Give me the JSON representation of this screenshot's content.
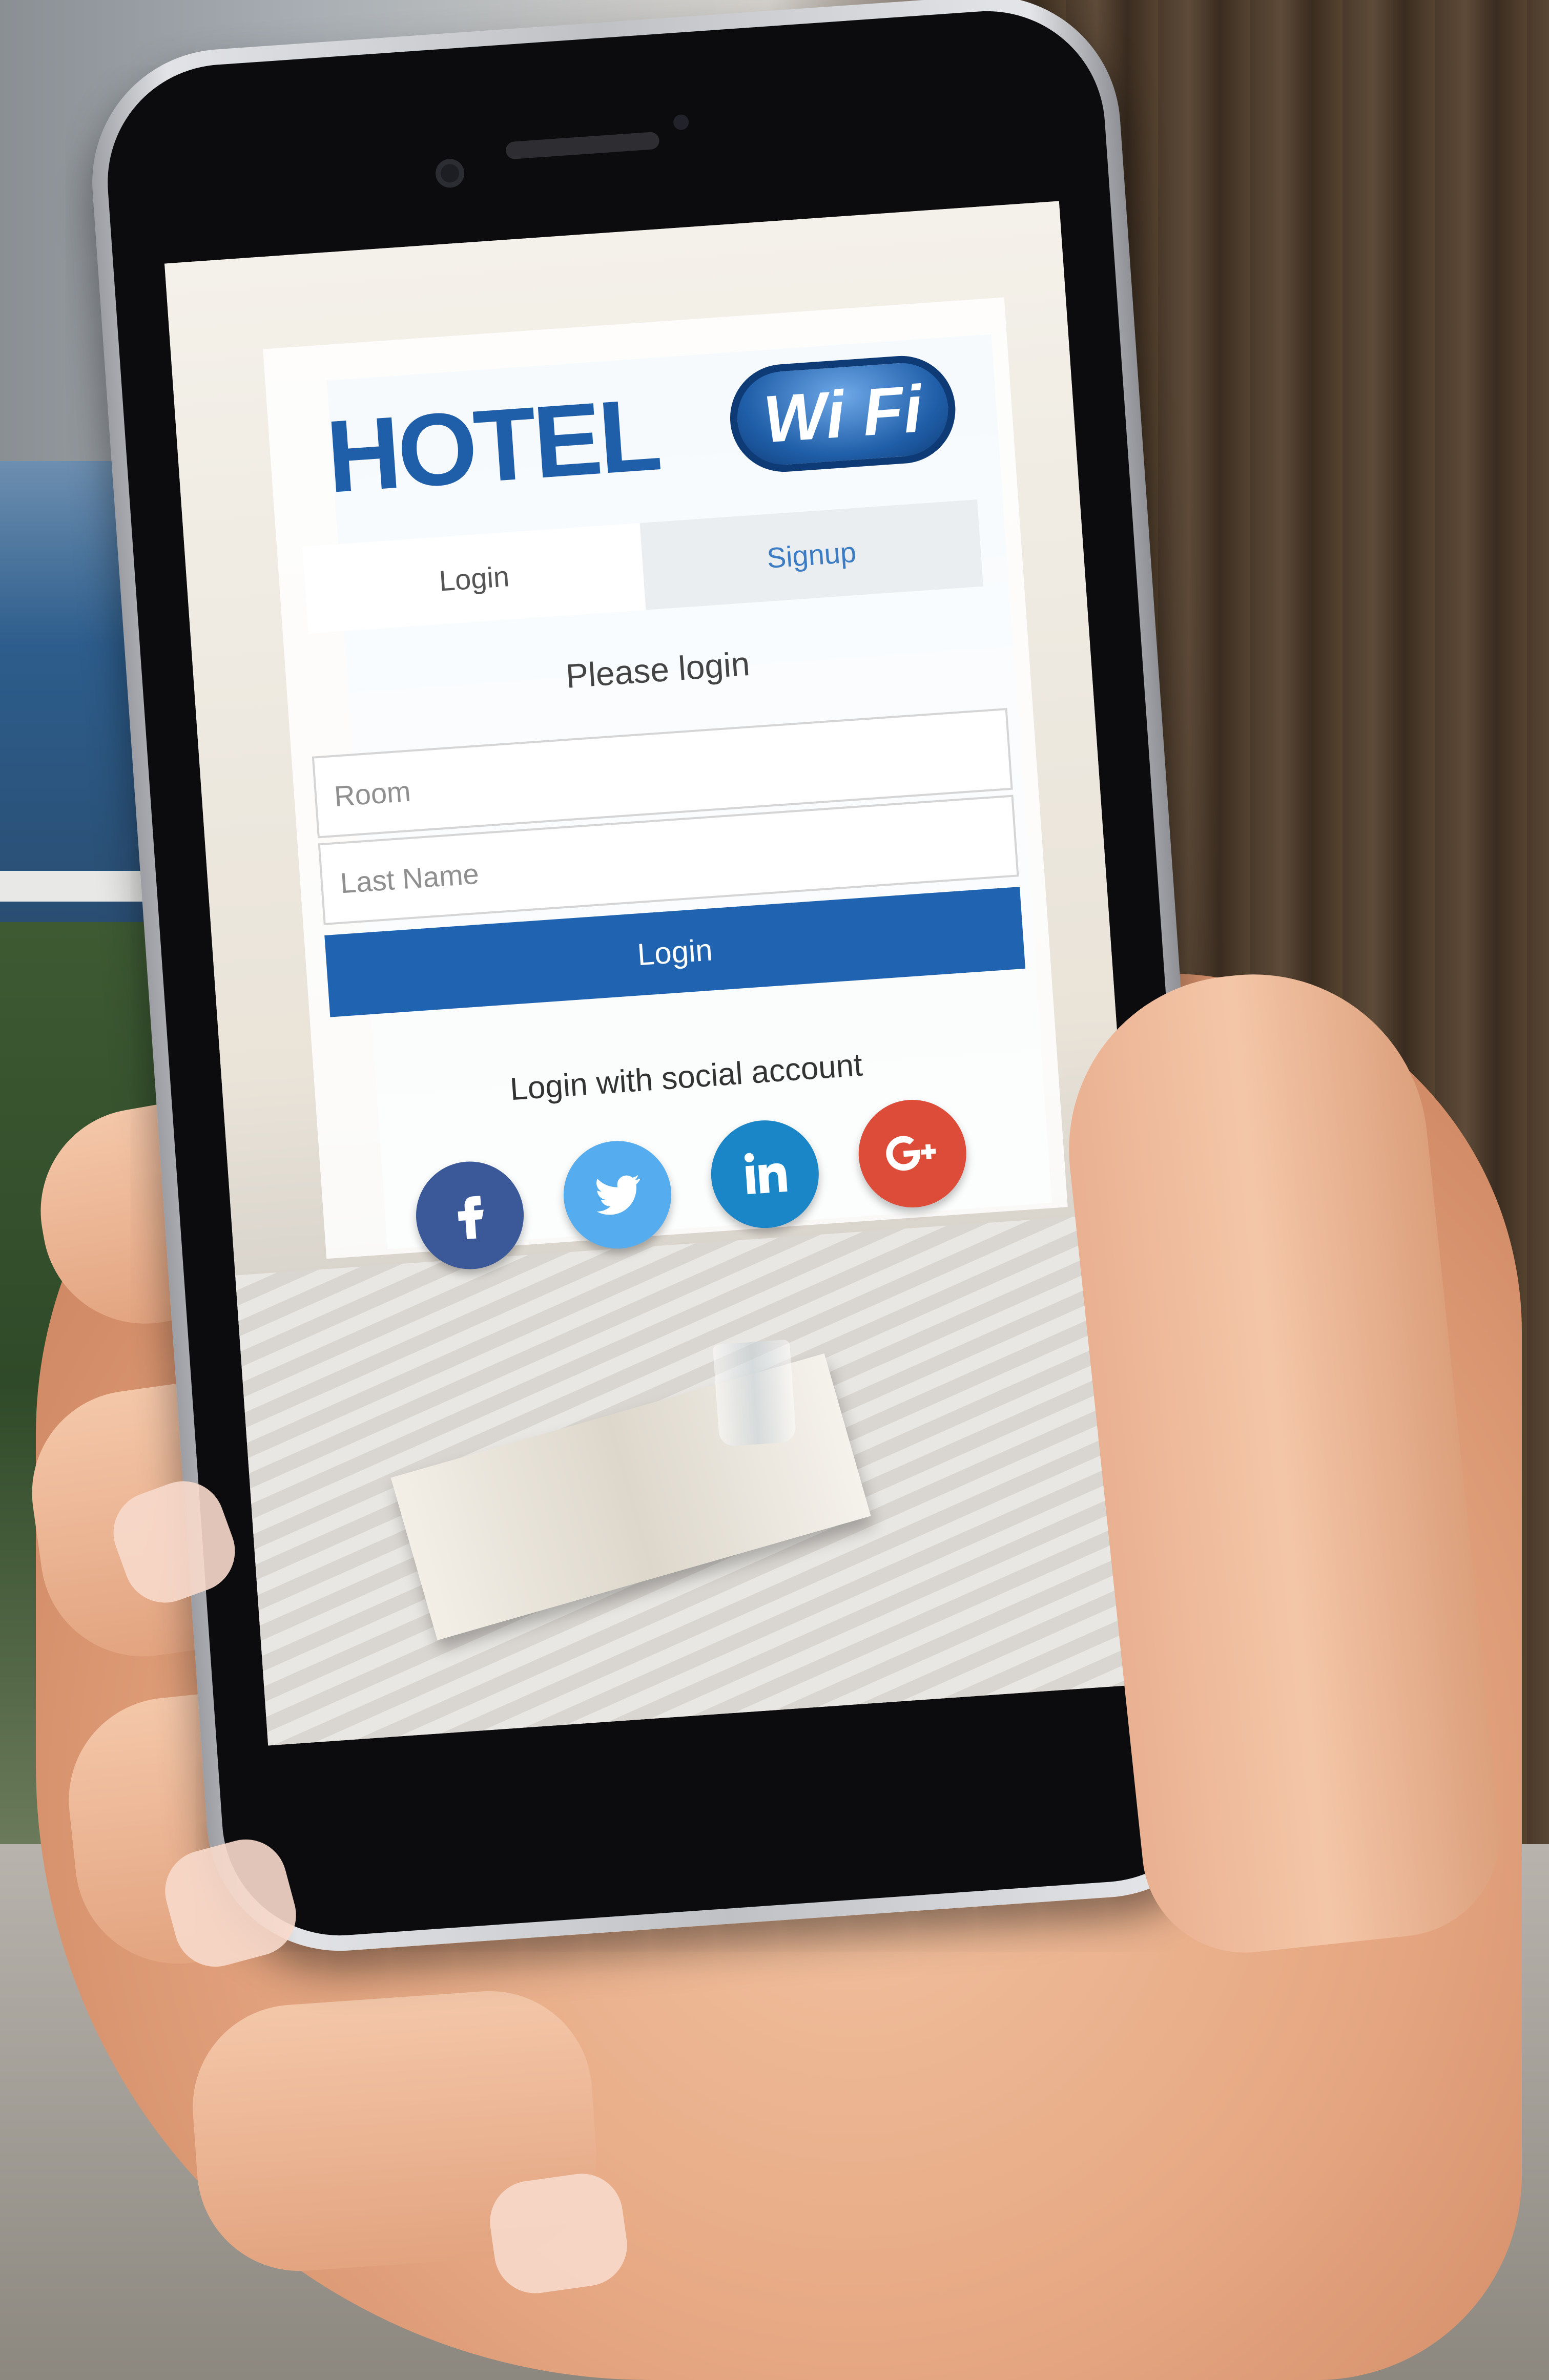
{
  "brand": {
    "hotel": "HOTEL",
    "wifi": "Wi Fi"
  },
  "tabs": [
    {
      "label": "Login"
    },
    {
      "label": "Signup"
    }
  ],
  "form": {
    "heading": "Please login",
    "room_placeholder": "Room",
    "lastname_placeholder": "Last Name",
    "submit_label": "Login"
  },
  "social": {
    "label": "Login with social account",
    "providers": [
      {
        "name": "facebook-icon",
        "color": "#3b5998"
      },
      {
        "name": "twitter-icon",
        "color": "#55acee"
      },
      {
        "name": "linkedin-icon",
        "color": "#1b86c7"
      },
      {
        "name": "google-plus-icon",
        "color": "#dd4b39"
      }
    ]
  },
  "colors": {
    "primary": "#1f63b1",
    "brand": "#1f5ea8"
  }
}
